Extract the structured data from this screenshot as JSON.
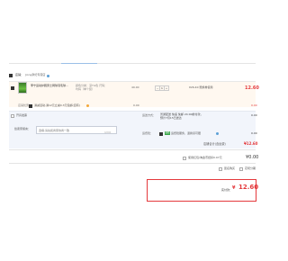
{
  "shop": {
    "name": "店铺：",
    "seller": "Jiong孕妇专营店",
    "sub_note": ""
  },
  "item": {
    "title": "李宁运动护腕男士网球羽毛球…",
    "meta": "颜色分类：深TG色  尺码：均码（单个装）",
    "price": "49.00",
    "qty_minus": "−",
    "qty": "1",
    "qty_plus": "+",
    "stock": "¥26.40 赠换券使用",
    "subtotal": "12.60"
  },
  "promo": {
    "label": "店铺优惠：",
    "text": "满减活动,满12元立减0.3元包邮(自有)",
    "value": "0.00",
    "total": "0.00"
  },
  "options": {
    "invoice_label": "开具发票",
    "message_label": "给卖家留言：",
    "message_placeholder": "选填,请先和商家协商一致",
    "message_count": "0/200",
    "ship_label": "运送方式：",
    "ship_value": "普通配送 快递 免邮 24:00前付款，预计7月15日送达",
    "ship_price": "0.00",
    "insurance_label": "运费险：",
    "insurance_badge": "保险",
    "insurance_text": "运费险服务，退换货可赔",
    "insurance_price": "0.00"
  },
  "shop_total": {
    "label": "店铺合计(含运费)",
    "value": "¥12.60"
  },
  "redpacket": {
    "text": "使用红包/淘金币抵扣0.07元",
    "value": "¥0.00"
  },
  "checkout": {
    "anonymous": "匿名购买",
    "fenqi": "花呗分期",
    "pay_label": "实付款：",
    "currency": "¥",
    "amount": "12.60"
  },
  "colors": {
    "accent": "#e4393c",
    "option_bg": "#f2f5fb",
    "item_bg": "#fff8f0"
  }
}
